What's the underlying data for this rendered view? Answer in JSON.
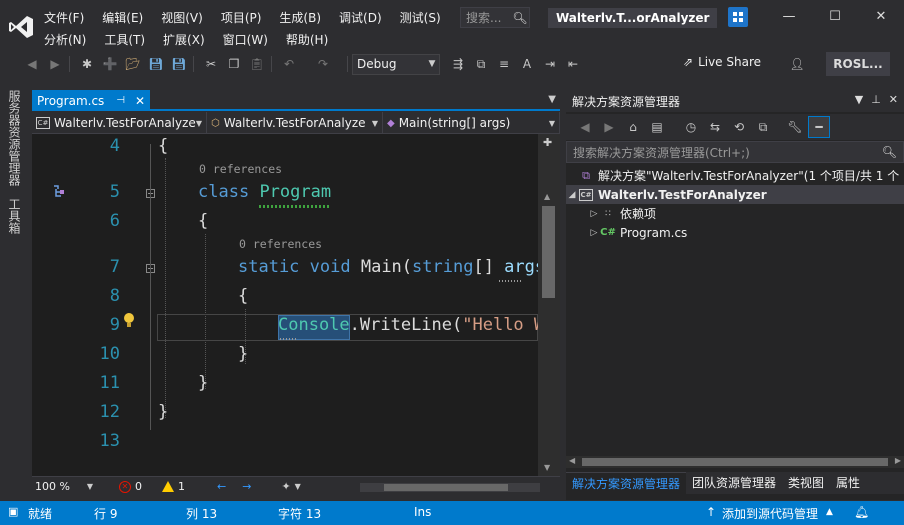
{
  "menu": {
    "row1": [
      "文件(F)",
      "编辑(E)",
      "视图(V)",
      "项目(P)",
      "生成(B)",
      "调试(D)",
      "测试(S)"
    ],
    "row2": [
      "分析(N)",
      "工具(T)",
      "扩展(X)",
      "窗口(W)",
      "帮助(H)"
    ],
    "search_placeholder": "搜索...",
    "window_title": "Walterlv.T...orAnalyzer"
  },
  "toolbar": {
    "configuration": "Debug",
    "live_share": "Live Share",
    "roslyn_label": "ROSL..."
  },
  "side_tabs": [
    "服务器资源管理器",
    "工具箱"
  ],
  "document_tab": {
    "label": "Program.cs"
  },
  "navigation_bar": {
    "project": "Walterlv.TestForAnalyze",
    "type": "Walterlv.TestForAnalyze",
    "member": "Main(string[] args)"
  },
  "editor": {
    "line_numbers": [
      "4",
      "5",
      "6",
      "7",
      "8",
      "9",
      "10",
      "11",
      "12",
      "13"
    ],
    "references_label": "0 references",
    "code": {
      "l4": "{",
      "l5_kw": "class",
      "l5_type": "Program",
      "l6": "{",
      "l7_kw": "static void",
      "l7_name": "Main(",
      "l7_param_type": "string",
      "l7_rest": "[] ",
      "l7_param": "args",
      "l8": "{",
      "l9_type": "Console",
      "l9_mid": ".WriteLine(",
      "l9_str": "\"Hello W",
      "l10": "}",
      "l11": "}",
      "l12": "}"
    }
  },
  "editor_status": {
    "zoom": "100 %",
    "errors": "0",
    "warnings": "1"
  },
  "solution_explorer": {
    "title": "解决方案资源管理器",
    "search_placeholder": "搜索解决方案资源管理器(Ctrl+;)",
    "solution_label": "解决方案\"Walterlv.TestForAnalyzer\"(1 个项目/共 1 个",
    "project_label": "Walterlv.TestForAnalyzer",
    "dependencies_label": "依赖项",
    "file_label": "Program.cs",
    "bottom_tabs": [
      "解决方案资源管理器",
      "团队资源管理器",
      "类视图",
      "属性"
    ]
  },
  "statusbar": {
    "ready": "就绪",
    "line": "行 9",
    "col": "列 13",
    "char": "字符 13",
    "mode": "Ins",
    "source_control": "添加到源代码管理"
  },
  "colors": {
    "accent": "#007acc",
    "keyword": "#569cd6",
    "type": "#4ec9b0",
    "string": "#d69d85",
    "line_number": "#2b91af"
  }
}
